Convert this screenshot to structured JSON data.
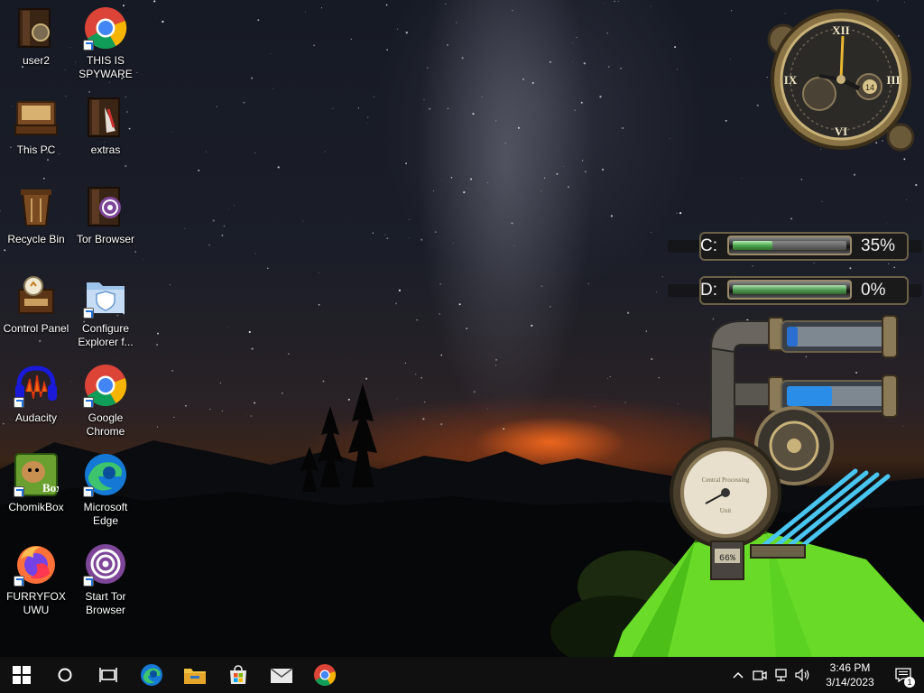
{
  "desktop": {
    "icons": [
      {
        "label": "user2",
        "icon": "user-folder-icon",
        "shortcut": false
      },
      {
        "label": "THIS IS SPYWARE",
        "icon": "chrome-icon",
        "shortcut": true
      },
      {
        "label": "This PC",
        "icon": "this-pc-icon",
        "shortcut": false
      },
      {
        "label": "extras",
        "icon": "extras-folder-icon",
        "shortcut": false
      },
      {
        "label": "Recycle Bin",
        "icon": "recycle-bin-icon",
        "shortcut": false
      },
      {
        "label": "Tor Browser",
        "icon": "tor-browser-folder-icon",
        "shortcut": false
      },
      {
        "label": "Control Panel",
        "icon": "control-panel-icon",
        "shortcut": false
      },
      {
        "label": "Configure Explorer f...",
        "icon": "shield-folder-icon",
        "shortcut": true
      },
      {
        "label": "Audacity",
        "icon": "audacity-icon",
        "shortcut": true
      },
      {
        "label": "Google Chrome",
        "icon": "chrome-icon",
        "shortcut": true
      },
      {
        "label": "ChomikBox",
        "icon": "chomikbox-icon",
        "shortcut": true
      },
      {
        "label": "Microsoft Edge",
        "icon": "edge-icon",
        "shortcut": true
      },
      {
        "label": "FURRYFOX UWU",
        "icon": "firefox-icon",
        "shortcut": true
      },
      {
        "label": "Start Tor Browser",
        "icon": "tor-icon",
        "shortcut": true
      }
    ]
  },
  "clock_gadget": {
    "numerals": [
      "XII",
      "III",
      "VI",
      "IX"
    ],
    "day_label": "14"
  },
  "drives": [
    {
      "letter": "C:",
      "percent_label": "35%",
      "used_fraction": 0.35
    },
    {
      "letter": "D:",
      "percent_label": "0%",
      "used_fraction": 0.0
    }
  ],
  "gauge_gadget": {
    "readout": "66%",
    "dial_text_top": "Central Processing",
    "dial_text_bottom": "Unit",
    "cpu_fraction": 0.66
  },
  "taskbar": {
    "start_icon": "windows-start-icon",
    "search_icon": "search-circle-icon",
    "task_view_icon": "task-view-icon",
    "pinned": [
      {
        "name": "edge",
        "icon": "edge-icon",
        "active": false
      },
      {
        "name": "file-explorer",
        "icon": "file-explorer-icon",
        "active": false
      },
      {
        "name": "store",
        "icon": "store-icon",
        "active": false
      },
      {
        "name": "mail",
        "icon": "mail-icon",
        "active": false
      },
      {
        "name": "chrome",
        "icon": "chrome-icon",
        "active": false
      }
    ],
    "tray": {
      "time": "3:46 PM",
      "date": "3/14/2023",
      "notification_count": "1"
    }
  },
  "colors": {
    "taskbar_bg": "#101010",
    "drive_fill": "#4fa54f",
    "tent_green": "#6fe62a"
  }
}
